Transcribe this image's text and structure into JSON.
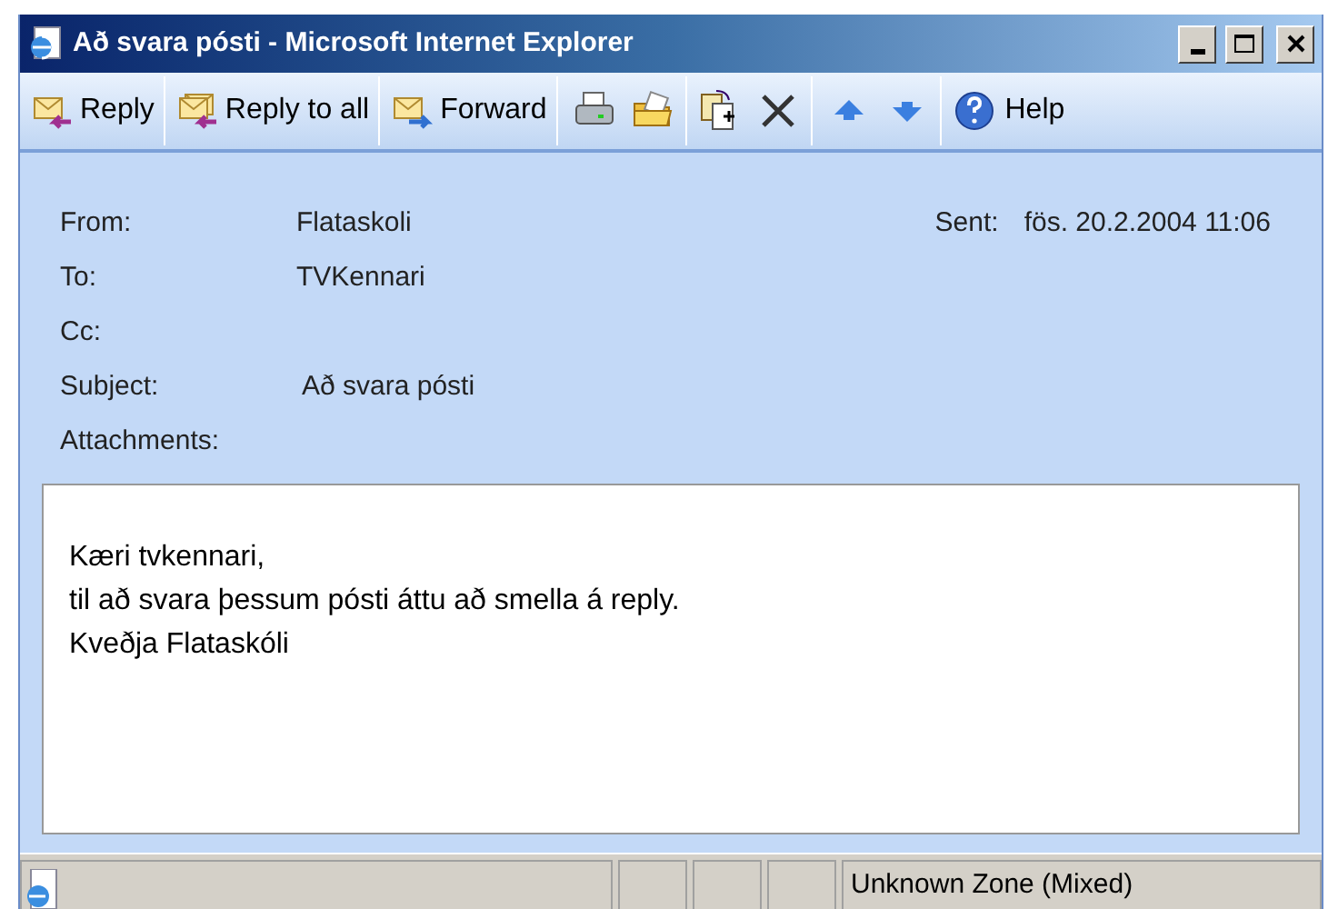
{
  "window": {
    "title": "Að svara pósti - Microsoft Internet Explorer"
  },
  "toolbar": [
    {
      "kind": "reply",
      "label": "Reply"
    },
    {
      "kind": "reply-all",
      "label": "Reply to all"
    },
    {
      "kind": "forward",
      "label": "Forward"
    },
    {
      "kind": "print"
    },
    {
      "kind": "folder"
    },
    {
      "kind": "copy"
    },
    {
      "kind": "delete"
    },
    {
      "kind": "up"
    },
    {
      "kind": "down"
    },
    {
      "kind": "help",
      "label": "Help"
    }
  ],
  "header": {
    "from_label": "From:",
    "from": "Flataskoli",
    "sent_label": "Sent:",
    "sent": "fös. 20.2.2004 11:06",
    "to_label": "To:",
    "to": "TVKennari",
    "cc_label": "Cc:",
    "subject_label": "Subject:",
    "subject": "Að svara pósti",
    "attachments_label": "Attachments:"
  },
  "body": [
    "Kæri tvkennari,",
    "til að svara þessum pósti áttu að smella á reply.",
    "Kveðja Flataskóli"
  ],
  "status_bar": {
    "zone": "Unknown Zone (Mixed)"
  }
}
